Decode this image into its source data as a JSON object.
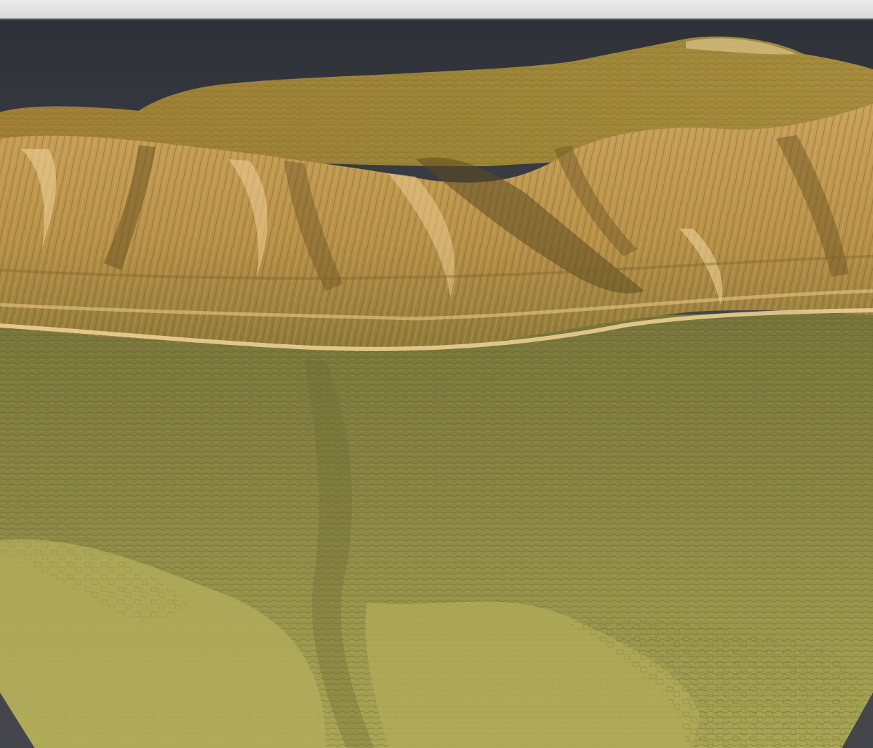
{
  "window": {
    "title": ""
  },
  "viewport": {
    "background_color": "#3a3c42",
    "terrain_palette": {
      "plateau_top": "#a88a3a",
      "cliff_face": "#d4a860",
      "cliff_shadow": "#6e5a2a",
      "slope": "#7a7a3a",
      "plain": "#a8a452",
      "lowland": "#b0ab58"
    }
  }
}
